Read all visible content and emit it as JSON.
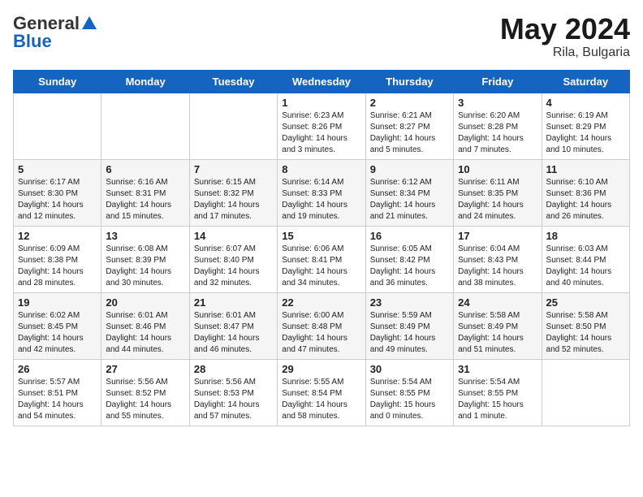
{
  "header": {
    "logo_general": "General",
    "logo_blue": "Blue",
    "month": "May 2024",
    "location": "Rila, Bulgaria"
  },
  "days_of_week": [
    "Sunday",
    "Monday",
    "Tuesday",
    "Wednesday",
    "Thursday",
    "Friday",
    "Saturday"
  ],
  "weeks": [
    [
      {
        "day": "",
        "sunrise": "",
        "sunset": "",
        "daylight": ""
      },
      {
        "day": "",
        "sunrise": "",
        "sunset": "",
        "daylight": ""
      },
      {
        "day": "",
        "sunrise": "",
        "sunset": "",
        "daylight": ""
      },
      {
        "day": "1",
        "sunrise": "6:23 AM",
        "sunset": "8:26 PM",
        "daylight": "14 hours and 3 minutes."
      },
      {
        "day": "2",
        "sunrise": "6:21 AM",
        "sunset": "8:27 PM",
        "daylight": "14 hours and 5 minutes."
      },
      {
        "day": "3",
        "sunrise": "6:20 AM",
        "sunset": "8:28 PM",
        "daylight": "14 hours and 7 minutes."
      },
      {
        "day": "4",
        "sunrise": "6:19 AM",
        "sunset": "8:29 PM",
        "daylight": "14 hours and 10 minutes."
      }
    ],
    [
      {
        "day": "5",
        "sunrise": "6:17 AM",
        "sunset": "8:30 PM",
        "daylight": "14 hours and 12 minutes."
      },
      {
        "day": "6",
        "sunrise": "6:16 AM",
        "sunset": "8:31 PM",
        "daylight": "14 hours and 15 minutes."
      },
      {
        "day": "7",
        "sunrise": "6:15 AM",
        "sunset": "8:32 PM",
        "daylight": "14 hours and 17 minutes."
      },
      {
        "day": "8",
        "sunrise": "6:14 AM",
        "sunset": "8:33 PM",
        "daylight": "14 hours and 19 minutes."
      },
      {
        "day": "9",
        "sunrise": "6:12 AM",
        "sunset": "8:34 PM",
        "daylight": "14 hours and 21 minutes."
      },
      {
        "day": "10",
        "sunrise": "6:11 AM",
        "sunset": "8:35 PM",
        "daylight": "14 hours and 24 minutes."
      },
      {
        "day": "11",
        "sunrise": "6:10 AM",
        "sunset": "8:36 PM",
        "daylight": "14 hours and 26 minutes."
      }
    ],
    [
      {
        "day": "12",
        "sunrise": "6:09 AM",
        "sunset": "8:38 PM",
        "daylight": "14 hours and 28 minutes."
      },
      {
        "day": "13",
        "sunrise": "6:08 AM",
        "sunset": "8:39 PM",
        "daylight": "14 hours and 30 minutes."
      },
      {
        "day": "14",
        "sunrise": "6:07 AM",
        "sunset": "8:40 PM",
        "daylight": "14 hours and 32 minutes."
      },
      {
        "day": "15",
        "sunrise": "6:06 AM",
        "sunset": "8:41 PM",
        "daylight": "14 hours and 34 minutes."
      },
      {
        "day": "16",
        "sunrise": "6:05 AM",
        "sunset": "8:42 PM",
        "daylight": "14 hours and 36 minutes."
      },
      {
        "day": "17",
        "sunrise": "6:04 AM",
        "sunset": "8:43 PM",
        "daylight": "14 hours and 38 minutes."
      },
      {
        "day": "18",
        "sunrise": "6:03 AM",
        "sunset": "8:44 PM",
        "daylight": "14 hours and 40 minutes."
      }
    ],
    [
      {
        "day": "19",
        "sunrise": "6:02 AM",
        "sunset": "8:45 PM",
        "daylight": "14 hours and 42 minutes."
      },
      {
        "day": "20",
        "sunrise": "6:01 AM",
        "sunset": "8:46 PM",
        "daylight": "14 hours and 44 minutes."
      },
      {
        "day": "21",
        "sunrise": "6:01 AM",
        "sunset": "8:47 PM",
        "daylight": "14 hours and 46 minutes."
      },
      {
        "day": "22",
        "sunrise": "6:00 AM",
        "sunset": "8:48 PM",
        "daylight": "14 hours and 47 minutes."
      },
      {
        "day": "23",
        "sunrise": "5:59 AM",
        "sunset": "8:49 PM",
        "daylight": "14 hours and 49 minutes."
      },
      {
        "day": "24",
        "sunrise": "5:58 AM",
        "sunset": "8:49 PM",
        "daylight": "14 hours and 51 minutes."
      },
      {
        "day": "25",
        "sunrise": "5:58 AM",
        "sunset": "8:50 PM",
        "daylight": "14 hours and 52 minutes."
      }
    ],
    [
      {
        "day": "26",
        "sunrise": "5:57 AM",
        "sunset": "8:51 PM",
        "daylight": "14 hours and 54 minutes."
      },
      {
        "day": "27",
        "sunrise": "5:56 AM",
        "sunset": "8:52 PM",
        "daylight": "14 hours and 55 minutes."
      },
      {
        "day": "28",
        "sunrise": "5:56 AM",
        "sunset": "8:53 PM",
        "daylight": "14 hours and 57 minutes."
      },
      {
        "day": "29",
        "sunrise": "5:55 AM",
        "sunset": "8:54 PM",
        "daylight": "14 hours and 58 minutes."
      },
      {
        "day": "30",
        "sunrise": "5:54 AM",
        "sunset": "8:55 PM",
        "daylight": "15 hours and 0 minutes."
      },
      {
        "day": "31",
        "sunrise": "5:54 AM",
        "sunset": "8:55 PM",
        "daylight": "15 hours and 1 minute."
      },
      {
        "day": "",
        "sunrise": "",
        "sunset": "",
        "daylight": ""
      }
    ]
  ]
}
